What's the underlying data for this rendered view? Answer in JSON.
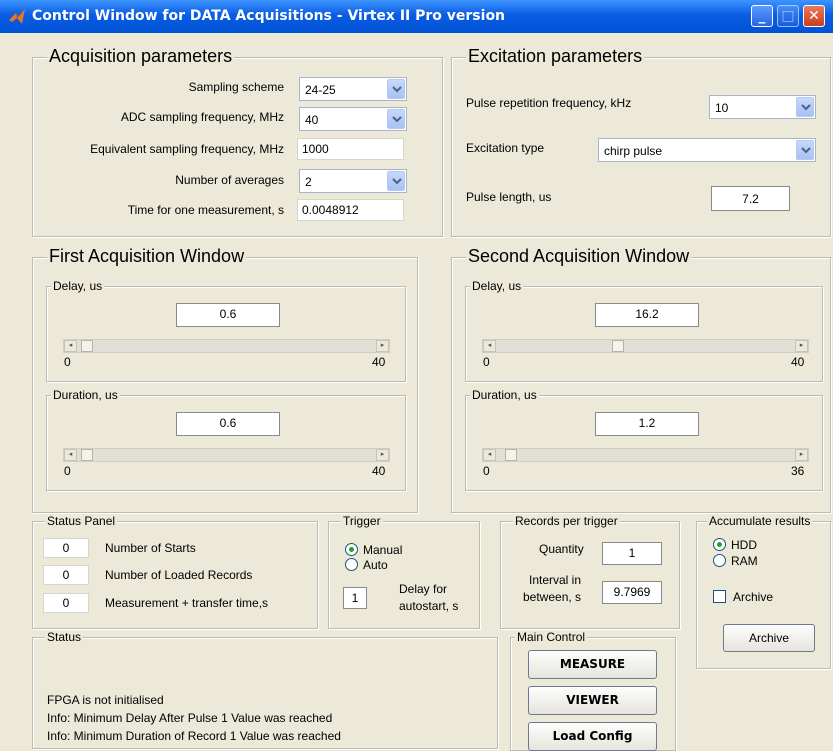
{
  "window": {
    "title": "Control Window for DATA Acquisitions - Virtex II Pro version",
    "minimize": "_",
    "maximize": "□",
    "close": "✕"
  },
  "acq": {
    "title": "Acquisition parameters",
    "sampling_scheme_label": "Sampling scheme",
    "sampling_scheme_value": "24-25",
    "adc_label": "ADC sampling frequency, MHz",
    "adc_value": "40",
    "eq_label": "Equivalent sampling frequency, MHz",
    "eq_value": "1000",
    "avg_label": "Number of averages",
    "avg_value": "2",
    "time_label": "Time for one measurement, s",
    "time_value": "0.0048912"
  },
  "exc": {
    "title": "Excitation parameters",
    "prf_label": "Pulse repetition frequency, kHz",
    "prf_value": "10",
    "type_label": "Excitation type",
    "type_value": "chirp pulse",
    "len_label": "Pulse length, us",
    "len_value": "7.2"
  },
  "first": {
    "title": "First Acquisition Window",
    "delay_title": "Delay, us",
    "delay_value": "0.6",
    "delay_min": "0",
    "delay_max": "40",
    "delay_frac": 0.015,
    "duration_title": "Duration, us",
    "duration_value": "0.6",
    "duration_min": "0",
    "duration_max": "40",
    "duration_frac": 0.015
  },
  "second": {
    "title": "Second  Acquisition Window",
    "delay_title": "Delay, us",
    "delay_value": "16.2",
    "delay_min": "0",
    "delay_max": "40",
    "delay_frac": 0.405,
    "duration_title": "Duration, us",
    "duration_value": "1.2",
    "duration_min": "0",
    "duration_max": "36",
    "duration_frac": 0.033
  },
  "status_panel": {
    "title": "Status Panel",
    "rows": [
      {
        "value": "0",
        "label": "Number of Starts"
      },
      {
        "value": "0",
        "label": "Number of Loaded Records"
      },
      {
        "value": "0",
        "label": "Measurement + transfer time,s"
      }
    ]
  },
  "trigger": {
    "title": "Trigger",
    "manual": "Manual",
    "auto": "Auto",
    "delay_value": "1",
    "delay_label_1": "Delay for",
    "delay_label_2": "autostart, s"
  },
  "records": {
    "title": "Records per trigger",
    "quantity_label": "Quantity",
    "quantity_value": "1",
    "interval_label_1": "Interval in",
    "interval_label_2": "between, s",
    "interval_value": "9.7969"
  },
  "accum": {
    "title": "Accumulate results",
    "hdd": "HDD",
    "ram": "RAM",
    "archive_check": "Archive",
    "archive_button": "Archive"
  },
  "status": {
    "title": "Status",
    "messages": [
      "FPGA is not initialised",
      "Info: Minimum Delay After Pulse 1 Value was reached",
      "Info: Minimum Duration of Record 1 Value was reached"
    ]
  },
  "main_control": {
    "title": "Main Control",
    "measure": "MEASURE",
    "viewer": "VIEWER",
    "load_config": "Load Config"
  },
  "colors": {
    "titlebar": "#0a5ce3",
    "background": "#ece9d8",
    "radio_dot": "#21a121"
  }
}
